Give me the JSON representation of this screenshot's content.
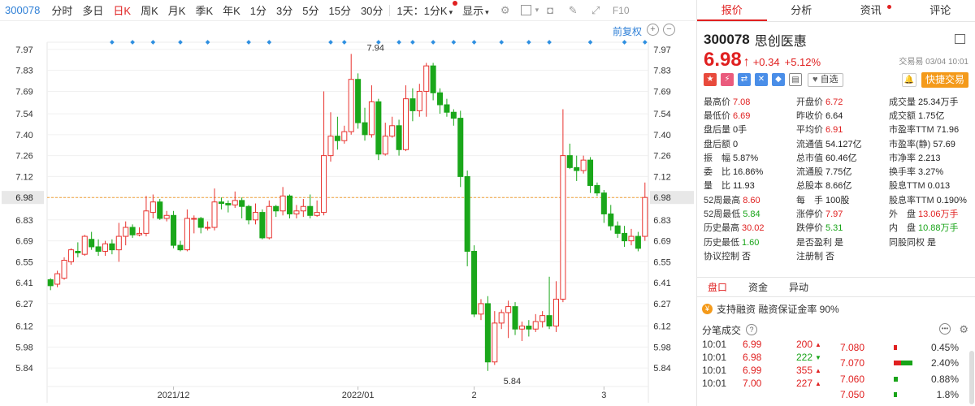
{
  "toolbar": {
    "code": "300078",
    "periods": [
      "分时",
      "多日",
      "日K",
      "周K",
      "月K",
      "季K",
      "年K",
      "1分",
      "3分",
      "5分",
      "15分",
      "30分"
    ],
    "active_period": "日K",
    "range_label": "1天：1分K",
    "display_label": "显示"
  },
  "chart_data": {
    "type": "candlestick",
    "y_ticks": [
      "7.97",
      "7.83",
      "7.69",
      "7.54",
      "7.40",
      "7.26",
      "7.12",
      "6.98",
      "6.83",
      "6.69",
      "6.55",
      "6.41",
      "6.27",
      "6.12",
      "5.98",
      "5.84"
    ],
    "ylim": [
      5.77,
      8.04
    ],
    "x_labels": [
      {
        "i": 12,
        "label": "2021/12"
      },
      {
        "i": 31,
        "label": "2022/01"
      },
      {
        "i": 42,
        "label": "2"
      },
      {
        "i": 55,
        "label": "3"
      }
    ],
    "current_price": "6.98",
    "high_label": "7.94",
    "low_label": "5.84",
    "restoration_label": "前复权",
    "series": [
      [
        6.43,
        6.39,
        6.44,
        6.36
      ],
      [
        6.4,
        6.47,
        6.49,
        6.38
      ],
      [
        6.44,
        6.56,
        6.58,
        6.43
      ],
      [
        6.55,
        6.63,
        6.64,
        6.53
      ],
      [
        6.62,
        6.61,
        6.68,
        6.58
      ],
      [
        6.6,
        6.72,
        6.73,
        6.59
      ],
      [
        6.7,
        6.65,
        6.75,
        6.63
      ],
      [
        6.65,
        6.62,
        6.7,
        6.59
      ],
      [
        6.62,
        6.67,
        6.69,
        6.59
      ],
      [
        6.67,
        6.63,
        6.7,
        6.6
      ],
      [
        6.63,
        6.72,
        6.81,
        6.55
      ],
      [
        6.72,
        6.78,
        6.82,
        6.66
      ],
      [
        6.78,
        6.73,
        6.8,
        6.71
      ],
      [
        6.73,
        6.74,
        6.78,
        6.72
      ],
      [
        6.74,
        6.89,
        6.99,
        6.72
      ],
      [
        6.88,
        6.95,
        7.0,
        6.84
      ],
      [
        6.95,
        6.84,
        6.97,
        6.83
      ],
      [
        6.84,
        6.86,
        6.89,
        6.82
      ],
      [
        6.86,
        6.66,
        6.89,
        6.64
      ],
      [
        6.66,
        6.63,
        6.69,
        6.62
      ],
      [
        6.63,
        6.84,
        6.9,
        6.62
      ],
      [
        6.84,
        6.84,
        6.86,
        6.74
      ],
      [
        6.84,
        6.78,
        6.85,
        6.74
      ],
      [
        6.78,
        6.78,
        6.82,
        6.76
      ],
      [
        6.78,
        6.95,
        7.04,
        6.76
      ],
      [
        6.95,
        6.94,
        6.98,
        6.9
      ],
      [
        6.94,
        6.93,
        6.96,
        6.88
      ],
      [
        6.93,
        6.96,
        7.02,
        6.91
      ],
      [
        6.96,
        6.92,
        6.98,
        6.84
      ],
      [
        6.92,
        6.83,
        6.93,
        6.8
      ],
      [
        6.83,
        6.88,
        6.94,
        6.8
      ],
      [
        6.88,
        6.71,
        6.9,
        6.7
      ],
      [
        6.71,
        6.92,
        6.96,
        6.7
      ],
      [
        6.92,
        6.89,
        6.93,
        6.85
      ],
      [
        6.89,
        6.99,
        7.05,
        6.86
      ],
      [
        6.99,
        6.87,
        7.0,
        6.84
      ],
      [
        6.87,
        6.89,
        6.93,
        6.84
      ],
      [
        6.89,
        6.92,
        6.97,
        6.85
      ],
      [
        6.92,
        6.86,
        7.0,
        6.84
      ],
      [
        6.86,
        6.88,
        6.96,
        6.85
      ],
      [
        6.88,
        7.26,
        7.69,
        6.86
      ],
      [
        7.26,
        7.39,
        7.55,
        7.22
      ],
      [
        7.39,
        7.36,
        7.52,
        7.3
      ],
      [
        7.36,
        7.42,
        7.46,
        7.34
      ],
      [
        7.42,
        7.77,
        7.94,
        7.4
      ],
      [
        7.77,
        7.48,
        7.81,
        7.44
      ],
      [
        7.48,
        7.4,
        7.58,
        7.36
      ],
      [
        7.4,
        7.62,
        7.73,
        7.38
      ],
      [
        7.62,
        7.27,
        7.64,
        7.23
      ],
      [
        7.27,
        7.39,
        7.48,
        7.26
      ],
      [
        7.39,
        7.46,
        7.52,
        7.38
      ],
      [
        7.46,
        7.3,
        7.5,
        7.26
      ],
      [
        7.3,
        7.64,
        7.73,
        7.29
      ],
      [
        7.64,
        7.56,
        7.71,
        7.49
      ],
      [
        7.56,
        7.69,
        7.74,
        7.52
      ],
      [
        7.69,
        7.86,
        7.88,
        7.52
      ],
      [
        7.86,
        7.68,
        7.88,
        7.63
      ],
      [
        7.68,
        7.6,
        7.71,
        7.54
      ],
      [
        7.6,
        7.55,
        7.64,
        7.52
      ],
      [
        7.55,
        7.51,
        7.57,
        7.46
      ],
      [
        7.51,
        7.12,
        7.56,
        7.05
      ],
      [
        7.12,
        6.62,
        7.16,
        6.52
      ],
      [
        6.62,
        6.2,
        6.66,
        6.18
      ],
      [
        6.2,
        6.27,
        6.3,
        6.16
      ],
      [
        6.27,
        5.88,
        6.32,
        5.82
      ],
      [
        5.88,
        6.14,
        6.22,
        5.86
      ],
      [
        6.14,
        6.21,
        6.23,
        6.1
      ],
      [
        6.21,
        6.25,
        6.29,
        6.04
      ],
      [
        6.25,
        6.1,
        6.28,
        6.06
      ],
      [
        6.1,
        6.12,
        6.15,
        6.02
      ],
      [
        6.12,
        6.1,
        6.16,
        6.05
      ],
      [
        6.1,
        6.15,
        6.2,
        6.08
      ],
      [
        6.15,
        6.19,
        6.22,
        6.11
      ],
      [
        6.19,
        6.12,
        6.45,
        6.1
      ],
      [
        6.12,
        6.3,
        6.42,
        6.08
      ],
      [
        6.3,
        7.26,
        7.57,
        6.28
      ],
      [
        7.26,
        7.18,
        7.34,
        7.17
      ],
      [
        7.18,
        7.16,
        7.26,
        7.09
      ],
      [
        7.16,
        7.23,
        7.26,
        7.14
      ],
      [
        7.23,
        7.06,
        7.25,
        7.01
      ],
      [
        7.06,
        7.01,
        7.08,
        6.99
      ],
      [
        7.01,
        6.87,
        7.03,
        6.81
      ],
      [
        6.87,
        6.79,
        6.93,
        6.76
      ],
      [
        6.79,
        6.74,
        6.82,
        6.71
      ],
      [
        6.74,
        6.69,
        6.79,
        6.65
      ],
      [
        6.69,
        6.72,
        6.77,
        6.66
      ],
      [
        6.72,
        6.64,
        6.75,
        6.62
      ],
      [
        6.72,
        6.98,
        7.08,
        6.69
      ]
    ]
  },
  "panel": {
    "tabs": [
      "报价",
      "分析",
      "资讯",
      "评论"
    ],
    "stock_code": "300078",
    "stock_name": "思创医惠",
    "price": "6.98",
    "change": "+0.34",
    "change_pct": "+5.12%",
    "trade_time": "交易易 03/04 10:01",
    "self_select": "自选",
    "quick_trade": "快捷交易",
    "stats": [
      [
        [
          "最高价",
          "7.08",
          "red"
        ],
        [
          "开盘价",
          "6.72",
          "red"
        ],
        [
          "成交量",
          "25.34万手",
          ""
        ]
      ],
      [
        [
          "最低价",
          "6.69",
          "red"
        ],
        [
          "昨收价",
          "6.64",
          ""
        ],
        [
          "成交额",
          "1.75亿",
          ""
        ]
      ],
      [
        [
          "盘后量",
          "0手",
          ""
        ],
        [
          "平均价",
          "6.91",
          "red"
        ],
        [
          "市盈率TTM",
          "71.96",
          ""
        ]
      ],
      [
        [
          "盘后额",
          "0",
          ""
        ],
        [
          "流通值",
          "54.127亿",
          ""
        ],
        [
          "市盈率(静)",
          "57.69",
          ""
        ]
      ],
      [
        [
          "振　幅",
          "5.87%",
          ""
        ],
        [
          "总市值",
          "60.46亿",
          ""
        ],
        [
          "市净率",
          "2.213",
          ""
        ]
      ],
      [
        [
          "委　比",
          "16.86%",
          ""
        ],
        [
          "流通股",
          "7.75亿",
          ""
        ],
        [
          "换手率",
          "3.27%",
          ""
        ]
      ],
      [
        [
          "量　比",
          "11.93",
          ""
        ],
        [
          "总股本",
          "8.66亿",
          ""
        ],
        [
          "股息TTM",
          "0.013",
          ""
        ]
      ],
      [
        [
          "52周最高",
          "8.60",
          "red"
        ],
        [
          "每　手",
          "100股",
          ""
        ],
        [
          "股息率TTM",
          "0.190%",
          ""
        ]
      ],
      [
        [
          "52周最低",
          "5.84",
          "green"
        ],
        [
          "涨停价",
          "7.97",
          "red"
        ],
        [
          "外　盘",
          "13.06万手",
          "red"
        ]
      ],
      [
        [
          "历史最高",
          "30.02",
          "red"
        ],
        [
          "跌停价",
          "5.31",
          "green"
        ],
        [
          "内　盘",
          "10.88万手",
          "green"
        ]
      ],
      [
        [
          "历史最低",
          "1.60",
          "green"
        ],
        [
          "是否盈利",
          "是",
          ""
        ],
        [
          "同股同权",
          "是",
          ""
        ]
      ],
      [
        [
          "协议控制",
          "否",
          ""
        ],
        [
          "注册制",
          "否",
          ""
        ],
        [
          "",
          "",
          ""
        ]
      ]
    ],
    "subtabs": [
      "盘口",
      "资金",
      "异动"
    ],
    "margin_text": "支持融资 融资保证金率 90%",
    "ticks_title": "分笔成交",
    "ticks": [
      {
        "time": "10:01",
        "price": "6.99",
        "vol": "200",
        "dir": "up"
      },
      {
        "time": "10:01",
        "price": "6.98",
        "vol": "222",
        "dir": "down"
      },
      {
        "time": "10:01",
        "price": "6.99",
        "vol": "355",
        "dir": "up"
      },
      {
        "time": "10:01",
        "price": "7.00",
        "vol": "227",
        "dir": "up"
      }
    ],
    "depth": [
      {
        "price": "7.080",
        "pct": "0.45%",
        "red": 0.1,
        "green": 0
      },
      {
        "price": "7.070",
        "pct": "2.40%",
        "red": 0.25,
        "green": 0.4
      },
      {
        "price": "7.060",
        "pct": "0.88%",
        "red": 0,
        "green": 0.15
      },
      {
        "price": "7.050",
        "pct": "1.8%",
        "red": 0,
        "green": 0.12
      }
    ]
  }
}
